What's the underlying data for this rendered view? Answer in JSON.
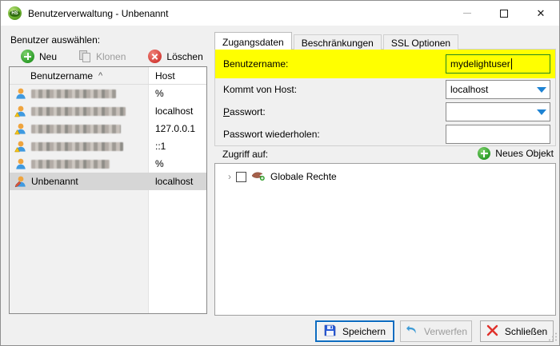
{
  "window": {
    "title": "Benutzerverwaltung - Unbenannt"
  },
  "icons": {
    "app": "HS",
    "minimize": "minimize-dash",
    "maximize": "maximize-square",
    "close": "✕",
    "sort_ascending": "^",
    "tree_chevron": "›"
  },
  "colors": {
    "highlight_yellow": "#ffff00",
    "focused_field_border": "#23871f",
    "accent_blue": "#0d6cc0",
    "combo_arrow_blue": "#1e83d3",
    "green_add": "#2e9e2a",
    "red_delete": "#d5403a",
    "selection_gray": "#d6d6d6",
    "titlebar": "#ffffff",
    "dialog_bg": "#f0f0f0"
  },
  "left_panel": {
    "label": "Benutzer auswählen:",
    "toolbar": {
      "new": "Neu",
      "clone": "Klonen",
      "delete": "Löschen",
      "clone_disabled": true
    },
    "user_list": {
      "columns": [
        "Benutzername",
        "Host"
      ],
      "sort_indicator": "^",
      "sorted_column": "Benutzername",
      "rows": [
        {
          "username": "",
          "redacted": true,
          "host": "%",
          "badge": "none",
          "selected": false
        },
        {
          "username": "",
          "redacted": true,
          "host": "localhost",
          "badge": "warning",
          "selected": false
        },
        {
          "username": "",
          "redacted": true,
          "host": "127.0.0.1",
          "badge": "warning",
          "selected": false
        },
        {
          "username": "",
          "redacted": true,
          "host": "::1",
          "badge": "warning",
          "selected": false
        },
        {
          "username": "",
          "redacted": true,
          "host": "%",
          "badge": "none",
          "selected": false
        },
        {
          "username": "Unbenannt",
          "redacted": false,
          "host": "localhost",
          "badge": "edit",
          "selected": true
        }
      ]
    }
  },
  "tabs": [
    {
      "label": "Zugangsdaten",
      "active": true
    },
    {
      "label": "Beschränkungen",
      "active": false
    },
    {
      "label": "SSL Optionen",
      "active": false
    }
  ],
  "form": {
    "username": {
      "label": "Benutzername:",
      "value": "mydelightuser",
      "highlighted": true
    },
    "from_host": {
      "label": "Kommt von Host:",
      "value": "localhost"
    },
    "password": {
      "label_accel": "P",
      "label_rest": "asswort:",
      "value": ""
    },
    "password_repeat": {
      "label": "Passwort wiederholen:",
      "value": ""
    }
  },
  "access": {
    "label": "Zugriff auf:",
    "new_object_label": "Neues Objekt",
    "tree": [
      {
        "label": "Globale Rechte",
        "checked": false,
        "expanded": false
      }
    ]
  },
  "footer": {
    "save": "Speichern",
    "discard": "Verwerfen",
    "discard_disabled": true,
    "close": "Schließen"
  }
}
